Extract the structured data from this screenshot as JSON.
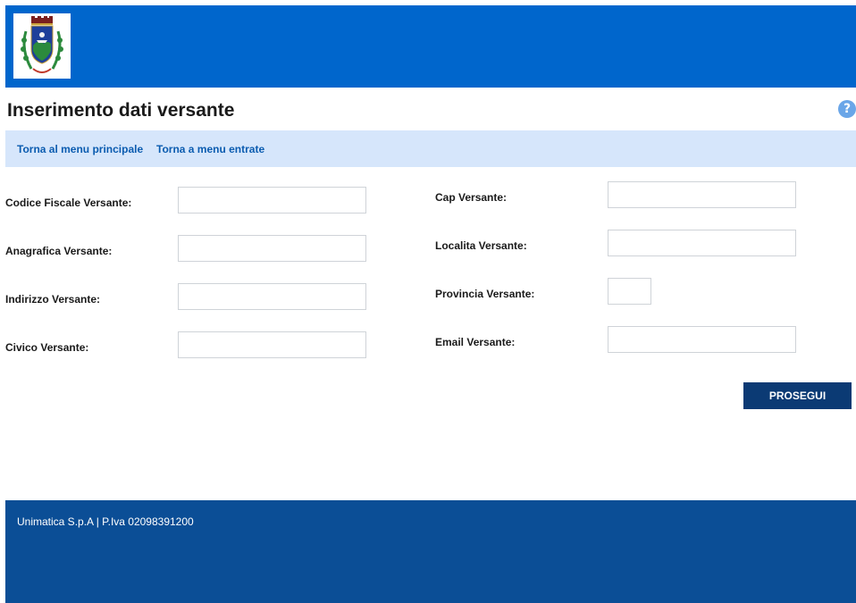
{
  "header": {
    "logo_icon": "municipal-crest-logo",
    "background_color": "#0066cc"
  },
  "page": {
    "title": "Inserimento dati versante",
    "help_icon": "question-mark-icon",
    "help_glyph": "?"
  },
  "nav": {
    "links": [
      {
        "label": "Torna al menu principale"
      },
      {
        "label": "Torna a menu entrate"
      }
    ]
  },
  "form": {
    "left": [
      {
        "label": "Codice Fiscale Versante:",
        "value": ""
      },
      {
        "label": "Anagrafica Versante:",
        "value": ""
      },
      {
        "label": "Indirizzo Versante:",
        "value": ""
      },
      {
        "label": "Civico Versante:",
        "value": ""
      }
    ],
    "right": [
      {
        "label": "Cap Versante:",
        "value": ""
      },
      {
        "label": "Localita Versante:",
        "value": ""
      },
      {
        "label": "Provincia Versante:",
        "value": ""
      },
      {
        "label": "Email Versante:",
        "value": ""
      }
    ],
    "submit_label": "PROSEGUI"
  },
  "footer": {
    "text": "Unimatica S.p.A | P.Iva 02098391200"
  },
  "colors": {
    "header": "#0066cc",
    "nav_bar": "#d6e6fb",
    "nav_link": "#0b5cb0",
    "button": "#0b3a74",
    "footer": "#0b4e96"
  }
}
